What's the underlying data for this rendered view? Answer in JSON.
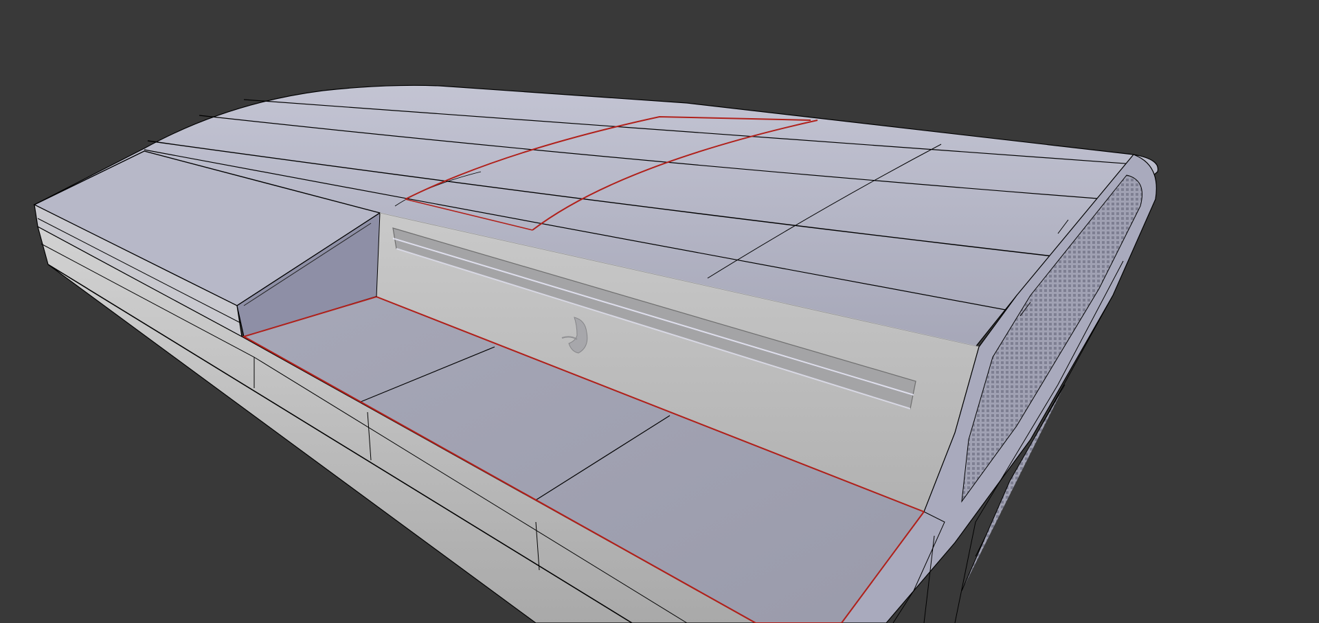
{
  "viewport": {
    "background": "#393939",
    "object": "3d-mesh-model",
    "mode": "edit-mode-wireframe-overlay"
  },
  "colors": {
    "top_light": "#b4b5c4",
    "top_mid": "#a9aabb",
    "panel_grey": "#b8b8b8",
    "panel_shadow": "#8a8a8e",
    "tray_floor": "#9c9dac",
    "wire": "#000000",
    "seam": "#b0201a",
    "grille": "#8e8fa0"
  },
  "icons": {
    "logo": "playstation-logo-icon"
  }
}
